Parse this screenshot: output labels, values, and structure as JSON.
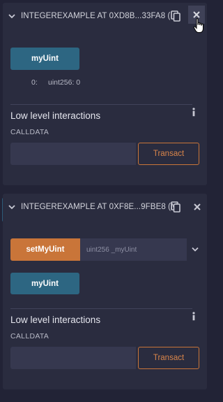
{
  "instances": [
    {
      "title": "INTEGEREXAMPLE AT 0XD8B...33FA8 (I",
      "functions": [
        {
          "label": "myUint",
          "kind": "call"
        }
      ],
      "outputs": [
        {
          "index": "0:",
          "value": "uint256: 0"
        }
      ],
      "low_level": {
        "title": "Low level interactions",
        "calldata_label": "CALLDATA",
        "transact_label": "Transact"
      }
    },
    {
      "title": "INTEGEREXAMPLE AT 0XF8E...9FBE8 (M",
      "functions": [
        {
          "label": "setMyUint",
          "kind": "transact",
          "placeholder": "uint256 _myUint"
        },
        {
          "label": "myUint",
          "kind": "call"
        }
      ],
      "low_level": {
        "title": "Low level interactions",
        "calldata_label": "CALLDATA",
        "transact_label": "Transact"
      }
    }
  ],
  "icons": {
    "collapse": "chevron-down-icon",
    "copy": "copy-icon",
    "close": "close-icon",
    "info": "info-icon",
    "expand": "chevron-down-icon",
    "cursor": "hand-pointer-icon"
  },
  "colors": {
    "background": "#222336",
    "panel": "#2a2c3f",
    "call_button": "#2d6682",
    "transact_button": "#c97539",
    "input": "#36384f"
  }
}
